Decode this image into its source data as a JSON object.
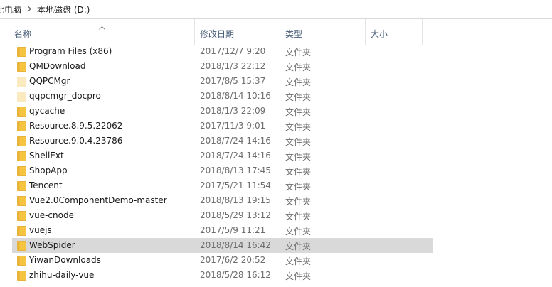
{
  "breadcrumb": {
    "items": [
      "此电脑",
      "本地磁盘 (D:)"
    ]
  },
  "columns": {
    "name": "名称",
    "date": "修改日期",
    "type": "类型",
    "size": "大小"
  },
  "colors": {
    "folder_body": "#f5c542",
    "folder_tab": "#e9b23a",
    "folder_pale": "#fbeac0",
    "selected_bg": "#d9d9d9",
    "header_text": "#4c607a"
  },
  "files": [
    {
      "name": "Program Files (x86)",
      "date": "2017/12/7 9:20",
      "type": "文件夹",
      "icon": "folder-icon"
    },
    {
      "name": "QMDownload",
      "date": "2018/1/3 22:12",
      "type": "文件夹",
      "icon": "folder-icon"
    },
    {
      "name": "QQPCMgr",
      "date": "2017/8/5 15:37",
      "type": "文件夹",
      "icon": "folder-pale-icon"
    },
    {
      "name": "qqpcmgr_docpro",
      "date": "2018/8/14 10:16",
      "type": "文件夹",
      "icon": "folder-pale-icon"
    },
    {
      "name": "qycache",
      "date": "2018/1/3 22:09",
      "type": "文件夹",
      "icon": "folder-icon"
    },
    {
      "name": "Resource.8.9.5.22062",
      "date": "2017/11/3 9:01",
      "type": "文件夹",
      "icon": "folder-icon"
    },
    {
      "name": "Resource.9.0.4.23786",
      "date": "2018/7/24 14:16",
      "type": "文件夹",
      "icon": "folder-icon"
    },
    {
      "name": "ShellExt",
      "date": "2018/7/24 14:16",
      "type": "文件夹",
      "icon": "folder-icon"
    },
    {
      "name": "ShopApp",
      "date": "2018/8/13 17:45",
      "type": "文件夹",
      "icon": "folder-icon"
    },
    {
      "name": "Tencent",
      "date": "2017/5/21 11:54",
      "type": "文件夹",
      "icon": "folder-icon"
    },
    {
      "name": "Vue2.0ComponentDemo-master",
      "date": "2018/8/13 19:15",
      "type": "文件夹",
      "icon": "folder-icon"
    },
    {
      "name": "vue-cnode",
      "date": "2018/5/29 13:12",
      "type": "文件夹",
      "icon": "folder-icon"
    },
    {
      "name": "vuejs",
      "date": "2017/5/9 11:21",
      "type": "文件夹",
      "icon": "folder-icon"
    },
    {
      "name": "WebSpider",
      "date": "2018/8/14 16:42",
      "type": "文件夹",
      "icon": "folder-icon",
      "selected": true
    },
    {
      "name": "YiwanDownloads",
      "date": "2017/6/2 20:52",
      "type": "文件夹",
      "icon": "folder-icon"
    },
    {
      "name": "zhihu-daily-vue",
      "date": "2018/5/28 16:12",
      "type": "文件夹",
      "icon": "folder-icon"
    }
  ]
}
